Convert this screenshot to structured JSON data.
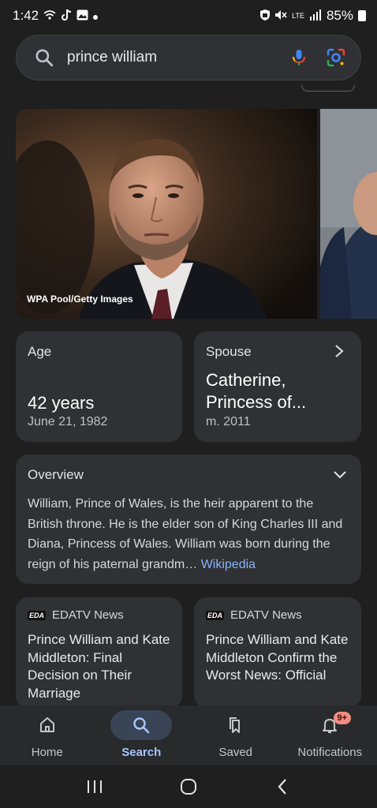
{
  "status_bar": {
    "time": "1:42",
    "battery": "85%",
    "network": "LTE"
  },
  "search": {
    "query": "prince william"
  },
  "hero": {
    "credit": "WPA Pool/Getty Images"
  },
  "age_card": {
    "label": "Age",
    "value": "42 years",
    "sub": "June 21, 1982"
  },
  "spouse_card": {
    "label": "Spouse",
    "value": "Catherine, Princess of...",
    "sub": "m. 2011"
  },
  "overview": {
    "title": "Overview",
    "text": "William, Prince of Wales, is the heir apparent to the British throne. He is the elder son of King Charles III and Diana, Princess of Wales. William was born during the reign of his paternal grandm…",
    "source": "Wikipedia"
  },
  "news": [
    {
      "source_logo": "EDA",
      "source": "EDATV News",
      "title": "Prince William and Kate Middleton: Final Decision on Their Marriage"
    },
    {
      "source_logo": "EDA",
      "source": "EDATV News",
      "title": "Prince William and Kate Middleton Confirm the Worst News: Official"
    }
  ],
  "bottom_nav": {
    "home": "Home",
    "search": "Search",
    "saved": "Saved",
    "notifications": "Notifications",
    "badge": "9+"
  },
  "colors": {
    "background": "#1f1f1f",
    "card": "#303134",
    "link": "#8ab4f8",
    "active_nav": "#a8c7fa"
  }
}
